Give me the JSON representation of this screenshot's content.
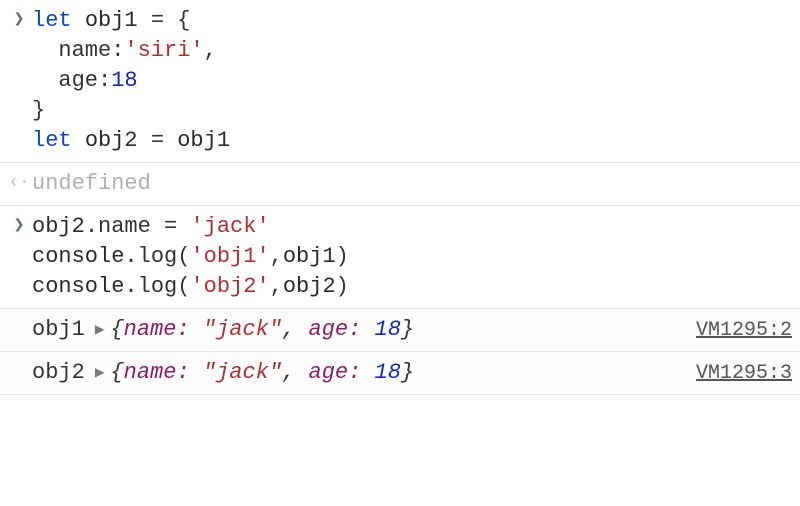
{
  "entries": [
    {
      "kind": "input",
      "lines": [
        [
          {
            "cls": "kw",
            "t": "let"
          },
          {
            "cls": "punct",
            "t": " "
          },
          {
            "cls": "ident",
            "t": "obj1"
          },
          {
            "cls": "punct",
            "t": " = {"
          }
        ],
        [
          {
            "cls": "punct",
            "t": "  "
          },
          {
            "cls": "prop",
            "t": "name"
          },
          {
            "cls": "punct",
            "t": ":"
          },
          {
            "cls": "str",
            "t": "'siri'"
          },
          {
            "cls": "punct",
            "t": ","
          }
        ],
        [
          {
            "cls": "punct",
            "t": "  "
          },
          {
            "cls": "prop",
            "t": "age"
          },
          {
            "cls": "punct",
            "t": ":"
          },
          {
            "cls": "num",
            "t": "18"
          }
        ],
        [
          {
            "cls": "punct",
            "t": "}"
          }
        ],
        [
          {
            "cls": "kw",
            "t": "let"
          },
          {
            "cls": "punct",
            "t": " "
          },
          {
            "cls": "ident",
            "t": "obj2"
          },
          {
            "cls": "punct",
            "t": " = "
          },
          {
            "cls": "ident",
            "t": "obj1"
          }
        ]
      ]
    },
    {
      "kind": "result",
      "text": "undefined"
    },
    {
      "kind": "input",
      "lines": [
        [
          {
            "cls": "ident",
            "t": "obj2"
          },
          {
            "cls": "punct",
            "t": "."
          },
          {
            "cls": "prop",
            "t": "name"
          },
          {
            "cls": "punct",
            "t": " = "
          },
          {
            "cls": "str",
            "t": "'jack'"
          }
        ],
        [
          {
            "cls": "ident",
            "t": "console"
          },
          {
            "cls": "punct",
            "t": "."
          },
          {
            "cls": "prop",
            "t": "log"
          },
          {
            "cls": "punct",
            "t": "("
          },
          {
            "cls": "str",
            "t": "'obj1'"
          },
          {
            "cls": "punct",
            "t": ","
          },
          {
            "cls": "ident",
            "t": "obj1"
          },
          {
            "cls": "punct",
            "t": ")"
          }
        ],
        [
          {
            "cls": "ident",
            "t": "console"
          },
          {
            "cls": "punct",
            "t": "."
          },
          {
            "cls": "prop",
            "t": "log"
          },
          {
            "cls": "punct",
            "t": "("
          },
          {
            "cls": "str",
            "t": "'obj2'"
          },
          {
            "cls": "punct",
            "t": ","
          },
          {
            "cls": "ident",
            "t": "obj2"
          },
          {
            "cls": "punct",
            "t": ")"
          }
        ]
      ]
    },
    {
      "kind": "log",
      "label": "obj1",
      "obj": {
        "name": "jack",
        "age": 18
      },
      "source": "VM1295:2"
    },
    {
      "kind": "log",
      "label": "obj2",
      "obj": {
        "name": "jack",
        "age": 18
      },
      "source": "VM1295:3"
    }
  ],
  "glyphs": {
    "input_prompt": "❯",
    "output_prefix": "‹·",
    "expand_tri": "▶"
  }
}
